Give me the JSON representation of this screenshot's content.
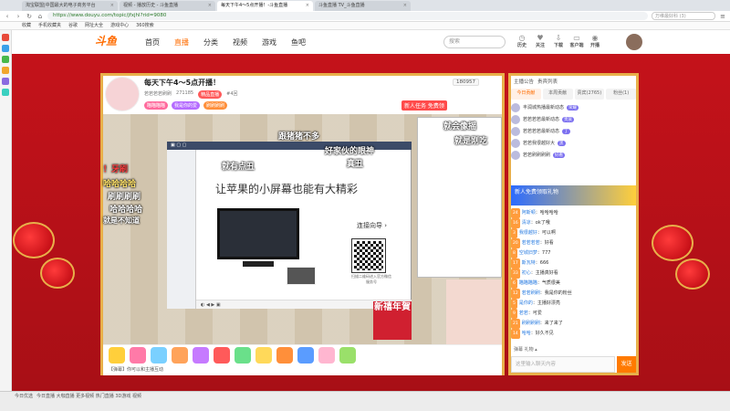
{
  "browser": {
    "tabs": [
      {
        "label": "淘宝联盟|中国最大的电子商务平台",
        "active": false
      },
      {
        "label": "视频 - 播放历史 - 斗鱼直播",
        "active": false
      },
      {
        "label": "每天下午4～5点开播！-斗鱼直播",
        "active": true
      },
      {
        "label": "斗鱼直播 TV_斗鱼直播",
        "active": false
      }
    ],
    "url": "https://www.douyu.com/topic/jfxjhl?rid=9080",
    "search_placeholder": "万维最好科 (3)",
    "bookmarks": [
      "收藏",
      "手机收藏夹",
      "谷歌",
      "网址大全",
      "游戏中心",
      "360搜索"
    ]
  },
  "site": {
    "logo": "斗鱼",
    "nav": [
      "首页",
      "直播",
      "分类",
      "视频",
      "游戏",
      "鱼吧"
    ],
    "active_nav": "直播",
    "search_placeholder": "搜索",
    "header_icons": [
      "历史",
      "关注",
      "下载",
      "客户端",
      "开播"
    ]
  },
  "stream": {
    "title": "每天下午4～5点开播！",
    "streamer_info": [
      "若若若若刷刷",
      "271185",
      "精品直播",
      "#4回"
    ],
    "badge_labels": [
      "瞄瞄瞄瞄",
      "我是你的爱",
      "刷刷刷刷"
    ],
    "follow_count": "180957",
    "task_button": "新人任务 免费领",
    "share_headline": "让苹果的小屏幕也能有大精彩",
    "connect_guide": "连接向导 ›",
    "qr_caption": "扫描二维码进入官方微信服务号",
    "danmu": [
      "哈哈哈哈",
      "刷刷刷刷",
      "跟猪猪不多",
      "好家伙的眼神",
      "真丑",
      "就是刚吃",
      "就有点丑",
      "就会像摇",
      "！牙刷",
      "哈哈哈哈",
      "就是不知道"
    ],
    "corner_text": "新禧年賀",
    "chat_input_hint": "【弹幕】你可以和主播互动"
  },
  "chat": {
    "tabs": [
      "主播公告",
      "贵宾列表"
    ],
    "subtabs": [
      "今日贡献",
      "本周贡献",
      "贵宾(2765)",
      "粉丝(1)"
    ],
    "ranks": [
      {
        "name": "丰润城热播最新动态",
        "badge": "荣耀"
      },
      {
        "name": "若若若若最新动态",
        "badge": "贵族"
      },
      {
        "name": "若若若若最新动态",
        "badge": "丁"
      },
      {
        "name": "若若我很越好大",
        "badge": "黑"
      },
      {
        "name": "若若刷刷刷刷",
        "badge": "好看"
      }
    ],
    "promo_text": "新人免费领取礼物",
    "messages": [
      {
        "lv": "24",
        "nick": "阿斯顿",
        "text": "哈哈哈哈"
      },
      {
        "lv": "16",
        "nick": "清凉",
        "text": "ok了哦"
      },
      {
        "lv": "3",
        "nick": "我很越好",
        "text": "可以啊"
      },
      {
        "lv": "20",
        "nick": "若若若若",
        "text": "好看"
      },
      {
        "lv": "8",
        "nick": "空城旧梦",
        "text": "777"
      },
      {
        "lv": "17",
        "nick": "斯瓦特",
        "text": "666"
      },
      {
        "lv": "33",
        "nick": "初心",
        "text": "主播真好看"
      },
      {
        "lv": "6",
        "nick": "瞄瞄瞄瞄",
        "text": "气质很美"
      },
      {
        "lv": "12",
        "nick": "若若刷刷",
        "text": "我是你的粉丝"
      },
      {
        "lv": "5",
        "nick": "是你的",
        "text": "主播好漂亮"
      },
      {
        "lv": "9",
        "nick": "若若",
        "text": "可爱"
      },
      {
        "lv": "21",
        "nick": "刷刷刷刷",
        "text": "来了来了"
      },
      {
        "lv": "14",
        "nick": "哈哈",
        "text": "好久不见"
      }
    ],
    "toolbar": "弹幕 礼物 ▴",
    "input_placeholder": "这里输入聊天内容",
    "send_label": "发送"
  },
  "statusbar": {
    "left": "今日优选",
    "middle": "今日直播 大咖直播 更多视频 热门直播 3D游戏 视频"
  }
}
